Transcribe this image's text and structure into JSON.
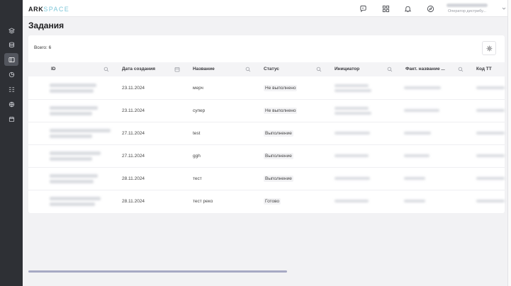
{
  "app": {
    "logo_main": "ARK",
    "logo_accent": "SPACE"
  },
  "sidebar": {
    "items": [
      {
        "icon": "layers-icon"
      },
      {
        "icon": "database-icon"
      },
      {
        "icon": "tasks-icon",
        "active": true
      },
      {
        "icon": "pie-chart-icon"
      },
      {
        "icon": "grid-list-icon"
      },
      {
        "icon": "globe-icon"
      },
      {
        "icon": "calendar-icon"
      }
    ]
  },
  "topbar": {
    "icons": [
      "chat-icon",
      "apps-grid-icon",
      "bell-icon",
      "compass-icon"
    ],
    "user_role": "Оператор дистрибу..."
  },
  "page": {
    "title": "Задания",
    "total_label": "Всего: 6"
  },
  "table": {
    "columns": [
      {
        "label": "ID",
        "icon": "search-icon"
      },
      {
        "label": "Дата создания",
        "icon": "calendar-icon"
      },
      {
        "label": "Название",
        "icon": "search-icon"
      },
      {
        "label": "Статус",
        "icon": "search-icon"
      },
      {
        "label": "Инициатор",
        "icon": "search-icon"
      },
      {
        "label": "Факт. название ...",
        "icon": "search-icon"
      },
      {
        "label": "Код ТТ",
        "icon": ""
      }
    ],
    "rows": [
      {
        "date": "23.11.2024",
        "name": "мерч",
        "status": "Не выполнено"
      },
      {
        "date": "23.11.2024",
        "name": "супер",
        "status": "Не выполнено"
      },
      {
        "date": "27.11.2024",
        "name": "test",
        "status": "Выполнение"
      },
      {
        "date": "27.11.2024",
        "name": "ggh",
        "status": "Выполнение"
      },
      {
        "date": "28.11.2024",
        "name": "тест",
        "status": "Выполнение"
      },
      {
        "date": "28.11.2024",
        "name": "тест реко",
        "status": "Готово"
      }
    ]
  },
  "scroll": {
    "horizontal_visible_fraction": 0.54
  }
}
